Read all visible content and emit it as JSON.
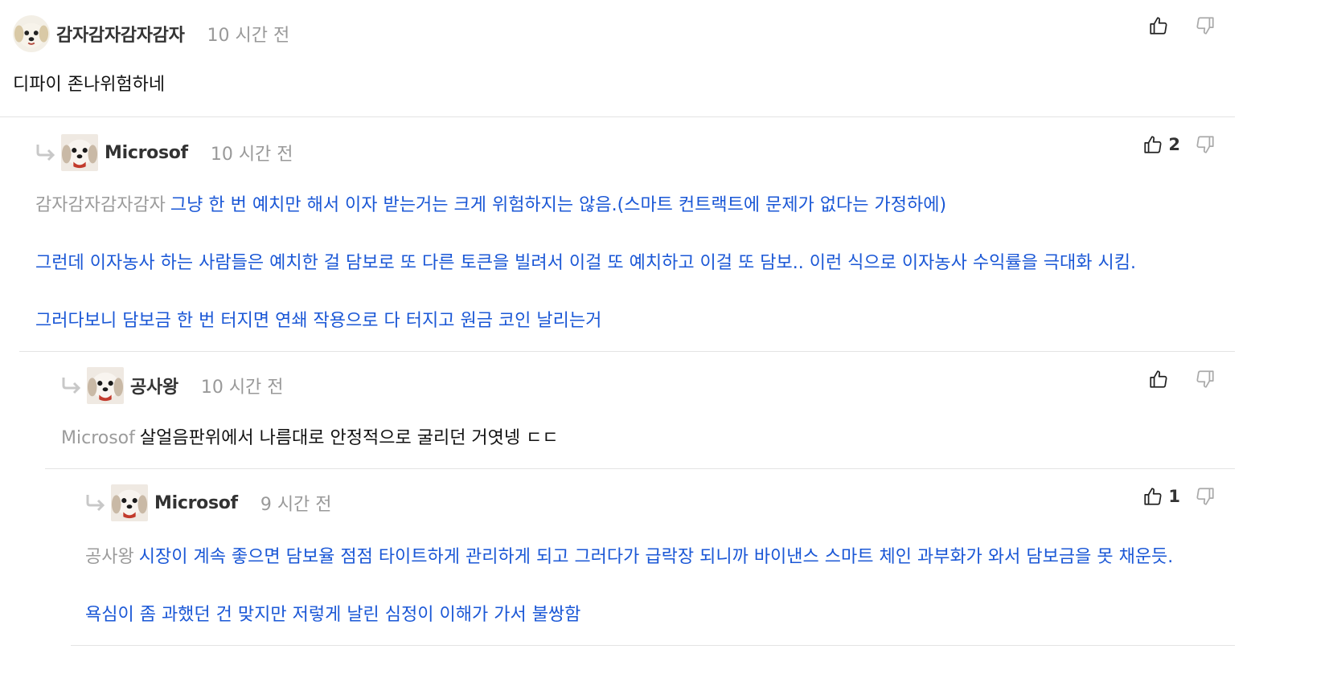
{
  "comments": [
    {
      "author": "감자감자감자감자",
      "time": "10 시간 전",
      "upvotes": "",
      "mention": "",
      "lines": [
        "디파이 존나위험하네"
      ]
    },
    {
      "author": "Microsof",
      "time": "10 시간 전",
      "upvotes": "2",
      "mention": "감자감자감자감자",
      "lines": [
        "그냥 한 번 예치만 해서 이자 받는거는 크게 위험하지는 않음.(스마트 컨트랙트에 문제가 없다는 가정하에)",
        "그런데 이자농사 하는 사람들은 예치한 걸 담보로 또 다른 토큰을 빌려서 이걸 또 예치하고 이걸 또 담보.. 이런 식으로 이자농사 수익률을 극대화 시킴.",
        "그러다보니 담보금 한 번 터지면 연쇄 작용으로 다 터지고 원금 코인 날리는거"
      ]
    },
    {
      "author": "공사왕",
      "time": "10 시간 전",
      "upvotes": "",
      "mention": "Microsof",
      "lines": [
        "살얼음판위에서 나름대로 안정적으로 굴리던 거엿넹 ㄷㄷ"
      ]
    },
    {
      "author": "Microsof",
      "time": "9 시간 전",
      "upvotes": "1",
      "mention": "공사왕",
      "lines": [
        "시장이 계속 좋으면 담보율 점점 타이트하게 관리하게 되고 그러다가 급락장 되니까 바이낸스 스마트 체인 과부화가 와서 담보금을 못 채운듯.",
        "욕심이 좀 과했던 건 맞지만 저렇게 날린 심정이 이해가 가서 불쌍함"
      ]
    }
  ],
  "icons": {
    "upvote": "thumbs-up-icon",
    "downvote": "thumbs-down-icon",
    "reply": "reply-arrow-icon"
  },
  "colors": {
    "text": "#111111",
    "link_blue": "#1a57d6",
    "muted": "#9b9b9b",
    "divider": "#e3e3e3"
  }
}
